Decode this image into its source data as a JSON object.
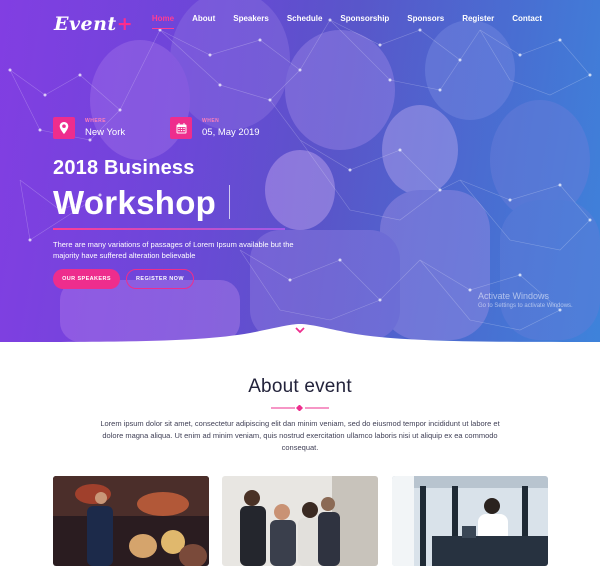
{
  "brand": {
    "name": "Event",
    "plus": "+"
  },
  "nav": {
    "items": [
      "Home",
      "About",
      "Speakers",
      "Schedule",
      "Sponsorship",
      "Sponsors",
      "Register",
      "Contact"
    ],
    "active": "Home"
  },
  "hero": {
    "where_label": "WHERE",
    "where_value": "New York",
    "when_label": "WHEN",
    "when_value": "05, May 2019",
    "title_line1": "2018 Business",
    "title_line2": "Workshop",
    "description": "There are many variations of passages of Lorem Ipsum available but the majority have suffered alteration believable",
    "btn_speakers": "OUR SPEAKERS",
    "btn_register": "REGISTER NOW"
  },
  "watermark": {
    "line1": "Activate Windows",
    "line2": "Go to Settings to activate Windows."
  },
  "about": {
    "title": "About event",
    "text": "Lorem ipsum dolor sit amet, consectetur adipiscing elit dan minim veniam, sed do eiusmod tempor incididunt ut labore et dolore magna aliqua. Ut enim ad minim veniam, quis nostrud exercitation ullamco laboris nisi ut aliquip ex ea commodo consequat."
  },
  "colors": {
    "accent": "#ee2d8d",
    "heading": "#23233b",
    "text": "#3f3f55"
  },
  "icons": {
    "where": "map-pin-icon",
    "when": "calendar-icon",
    "scroll": "chevron-down-icon"
  }
}
